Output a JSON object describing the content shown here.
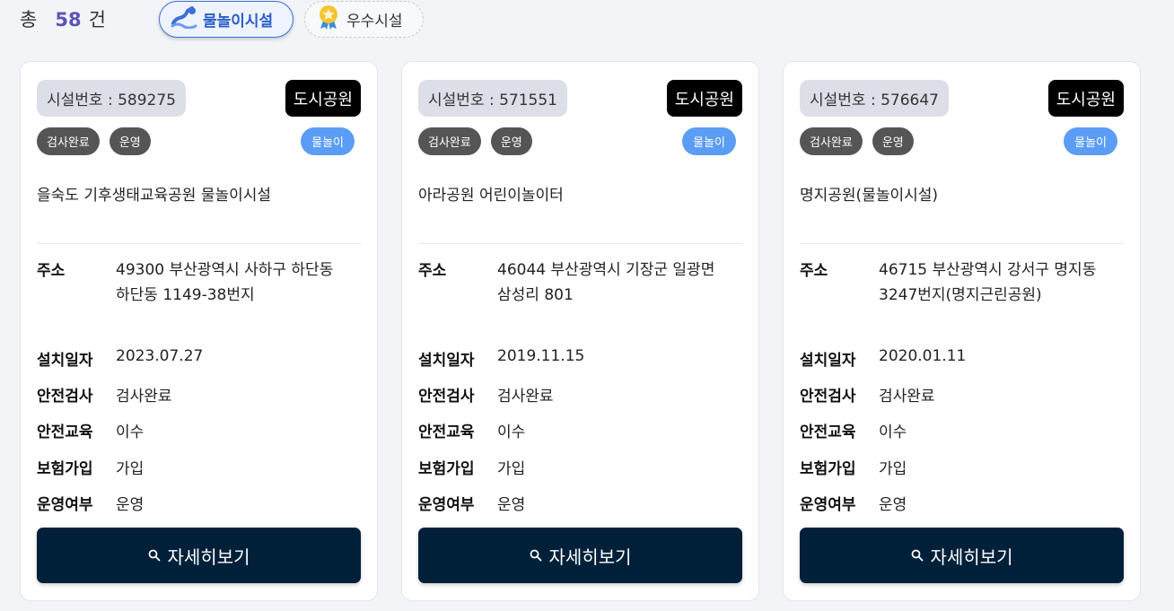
{
  "header": {
    "total_prefix": "총",
    "total_count": "58",
    "total_suffix": "건",
    "filters": [
      {
        "label": "물놀이시설",
        "icon": "water-slide-icon",
        "active": true
      },
      {
        "label": "우수시설",
        "icon": "award-medal-icon",
        "active": false
      }
    ]
  },
  "labels": {
    "address": "주소",
    "install_date": "설치일자",
    "safety_inspection": "안전검사",
    "safety_education": "안전교육",
    "insurance": "보험가입",
    "operation": "운영여부",
    "detail_button": "자세히보기"
  },
  "colors": {
    "accent": "#5b54b8",
    "button_bg": "#00203a",
    "kind_badge": "#5b9df5",
    "status_tag": "#555555"
  },
  "cards": [
    {
      "facility_no": "시설번호 : 589275",
      "type": "도시공원",
      "tags": [
        "검사완료",
        "운영"
      ],
      "kind": "물놀이",
      "name": "을숙도 기후생태교육공원 물놀이시설",
      "address_line1": "49300 부산광역시 사하구 하단동",
      "address_line2": "하단동 1149-38번지",
      "install_date": "2023.07.27",
      "safety_inspection": "검사완료",
      "safety_education": "이수",
      "insurance": "가입",
      "operation": "운영"
    },
    {
      "facility_no": "시설번호 : 571551",
      "type": "도시공원",
      "tags": [
        "검사완료",
        "운영"
      ],
      "kind": "물놀이",
      "name": "아라공원 어린이놀이터",
      "address_line1": "46044 부산광역시 기장군 일광면",
      "address_line2": "삼성리 801",
      "install_date": "2019.11.15",
      "safety_inspection": "검사완료",
      "safety_education": "이수",
      "insurance": "가입",
      "operation": "운영"
    },
    {
      "facility_no": "시설번호 : 576647",
      "type": "도시공원",
      "tags": [
        "검사완료",
        "운영"
      ],
      "kind": "물놀이",
      "name": "명지공원(물놀이시설)",
      "address_line1": "46715 부산광역시 강서구 명지동",
      "address_line2": "3247번지(명지근린공원)",
      "install_date": "2020.01.11",
      "safety_inspection": "검사완료",
      "safety_education": "이수",
      "insurance": "가입",
      "operation": "운영"
    }
  ]
}
